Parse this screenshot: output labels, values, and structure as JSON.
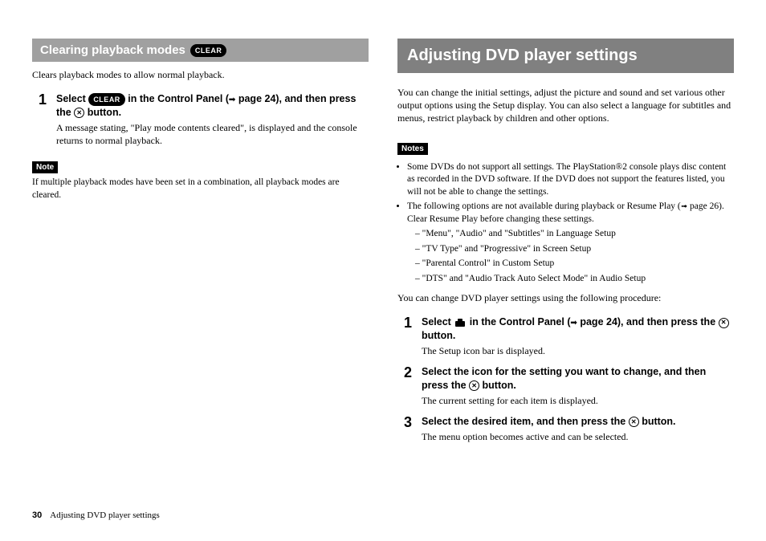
{
  "left": {
    "section_title": "Clearing playback modes",
    "clear_badge": "CLEAR",
    "intro": "Clears playback modes to allow normal playback.",
    "step1_num": "1",
    "step1_title_a": "Select ",
    "step1_title_b": " in the Control Panel (",
    "step1_title_c": " page 24), and then press the ",
    "step1_title_d": " button.",
    "step1_desc": "A message stating, \"Play mode contents cleared\", is displayed and the console returns to normal playback.",
    "note_label": "Note",
    "note_text": "If multiple playback modes have been set in a combination, all playback modes are cleared."
  },
  "right": {
    "title": "Adjusting DVD player settings",
    "intro": "You can change the initial settings, adjust the picture and sound and set various other output options using the Setup display. You can also select a language for subtitles and menus, restrict playback by children and other options.",
    "notes_label": "Notes",
    "bullet1": "Some DVDs do not support all settings. The PlayStation®2 console plays disc content as recorded in the DVD software. If the DVD does not support the features listed, you will not be able to change the settings.",
    "bullet2a": "The following options are not available during playback or Resume Play (",
    "bullet2b": " page 26). Clear Resume Play before changing these settings.",
    "sub1": "\"Menu\", \"Audio\" and \"Subtitles\" in Language Setup",
    "sub2": "\"TV Type\" and \"Progressive\" in Screen Setup",
    "sub3": "\"Parental Control\" in Custom Setup",
    "sub4": "\"DTS\" and \"Audio Track Auto Select Mode\" in Audio Setup",
    "procedure_intro": "You can change DVD player settings using the following procedure:",
    "step1_num": "1",
    "step1_title_a": "Select ",
    "step1_title_b": " in the Control Panel (",
    "step1_title_c": " page 24), and then press the ",
    "step1_title_d": " button.",
    "step1_desc": "The Setup icon bar is displayed.",
    "step2_num": "2",
    "step2_title_a": "Select the icon for the setting you want to change, and then press the ",
    "step2_title_b": " button.",
    "step2_desc": "The current setting for each item is displayed.",
    "step3_num": "3",
    "step3_title_a": "Select the desired item, and then press the ",
    "step3_title_b": " button.",
    "step3_desc": "The menu option becomes active and can be selected."
  },
  "footer": {
    "page_num": "30",
    "text": "Adjusting DVD player settings"
  },
  "icons": {
    "x": "✕",
    "arrow": "➟"
  }
}
